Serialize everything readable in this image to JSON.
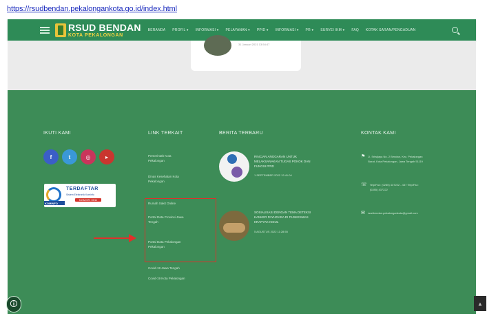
{
  "browser": {
    "url": "https://rsudbendan.pekalongankota.go.id/index.html"
  },
  "colors": {
    "nav_green": "#2e8b57",
    "footer_green": "#3d8c57",
    "annotation_red": "#e0302a",
    "facebook": "#3b5ec7",
    "twitter": "#3a98d8",
    "instagram": "#c9355b",
    "youtube": "#c9362f"
  },
  "header": {
    "logo_title": "RSUD BENDAN",
    "logo_subtitle": "KOTA PEKALONGAN",
    "menu": [
      "BERANDA",
      "PROFIL ▾",
      "INFORMASI ▾",
      "PELAYANAN ▾",
      "PPID ▾",
      "INFORMASI ▾",
      "PR ▾",
      "SURVEI IKM ▾",
      "FAQ",
      "KOTAK SARAN/PENGADUAN"
    ],
    "icons": {
      "menu": "hamburger-icon",
      "search": "search-icon"
    }
  },
  "card": {
    "text": "31 Januari 2021 13:54:47"
  },
  "footer": {
    "follow": {
      "heading": "IKUTI KAMI",
      "social": [
        {
          "icon": "facebook-icon",
          "glyph": "f"
        },
        {
          "icon": "twitter-icon",
          "glyph": "t"
        },
        {
          "icon": "instagram-icon",
          "glyph": "◎"
        },
        {
          "icon": "youtube-icon",
          "glyph": "▸"
        }
      ],
      "badge": {
        "title": "TERDAFTAR",
        "subtitle": "Sistem Elektronik Kominfo",
        "cert": "NOMOR: 0011",
        "strip": "KOMINFO"
      }
    },
    "links": {
      "heading": "LINK TERKAIT",
      "items": [
        "Pemerintah Kota\nPekalongan",
        "Dinas Kesehatan Kota\nPekalongan",
        "Rumah Sakit Online",
        "Portal Data Provinsi Jawa\nTengah",
        "Portal Data Pekalongan\nPekalongan",
        "Covid-19 Jawa Tengah",
        "Covid-19 Kota Pekalongan"
      ]
    },
    "news": {
      "heading": "BERITA TERBARU",
      "items": [
        {
          "title": "RINCIAN ANGGARAN UNTUK\nMELAKSANAKAN TUGAS POKOK DAN\nFUNGSI PPID",
          "date": "1 SEPTEMBER 2022 12:41:04"
        },
        {
          "title": "SOSIALISASI DENGAN TEMA DETEKSI\nKANKER PAYUDARA DI PUSKESMAS\nKRAPYAK KIDUL",
          "date": "5 AGUSTUS 2022 11:28:55"
        }
      ]
    },
    "contact": {
      "heading": "KONTAK KAMI",
      "items": [
        {
          "icon": "location-icon",
          "glyph": "⚑",
          "text": "Jl. Sriwijaya No. 2 Bendan, Kec. Pekalongan\nBarat, Kota Pekalongan, Jawa Tengah 51119"
        },
        {
          "icon": "phone-icon",
          "glyph": "☏",
          "text": "Telp/Fax: (0285) 437222 - 437 Telp/Fax:\n(0285) 437222"
        },
        {
          "icon": "email-icon",
          "glyph": "✉",
          "text": "rsudbendan.pekalongankota@gmail.com"
        }
      ]
    }
  },
  "widgets": {
    "accessibility_glyph": "🛈",
    "scroll_top_glyph": "▲"
  }
}
